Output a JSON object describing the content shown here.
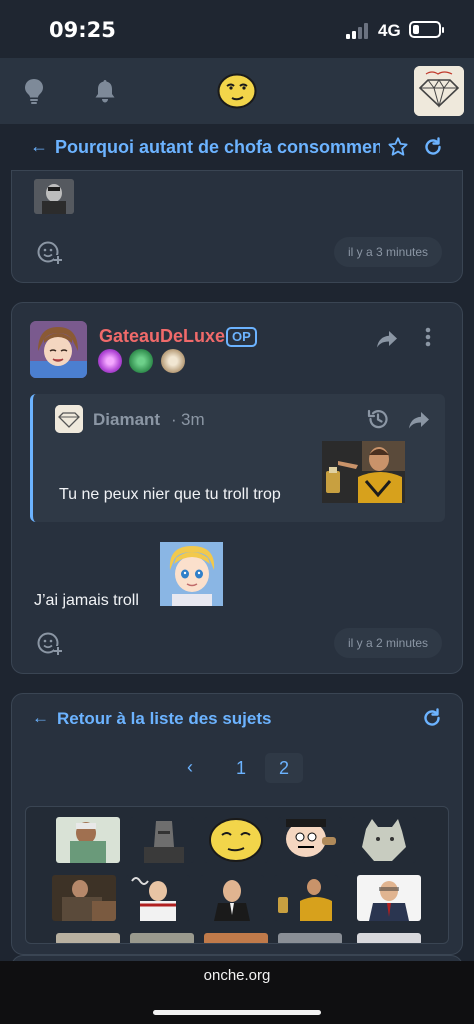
{
  "status_bar": {
    "time": "09:25",
    "network": "4G",
    "battery_level": 0.25
  },
  "topic": {
    "title": "Pourquoi autant de chofa consommen"
  },
  "prev_post": {
    "cut_text": "... ... ... ... ... ... ... ... ... ... ...",
    "time": "il y a 3 minutes"
  },
  "post": {
    "author": "GateauDeLuxe",
    "op_label": "OP",
    "quote": {
      "author": "Diamant",
      "separator": "·",
      "time": "3m",
      "text": "Tu ne peux nier que tu troll trop"
    },
    "text": "J’ai jamais troll",
    "time": "il y a 2 minutes"
  },
  "navigation": {
    "back_label": "Retour à la liste des sujets",
    "prev_glyph": "‹",
    "pages": [
      "1",
      "2"
    ],
    "current_page": "2"
  },
  "browser": {
    "url": "onche.org"
  },
  "colors": {
    "accent": "#6cb3ff",
    "author": "#f06a6a",
    "card": "#28313e",
    "background": "#1e2530"
  },
  "icons": [
    "lightbulb-icon",
    "bell-icon",
    "smiley-face-icon",
    "back-arrow-icon",
    "star-icon",
    "refresh-icon",
    "add-reaction-icon",
    "share-icon",
    "more-vertical-icon",
    "history-icon"
  ]
}
